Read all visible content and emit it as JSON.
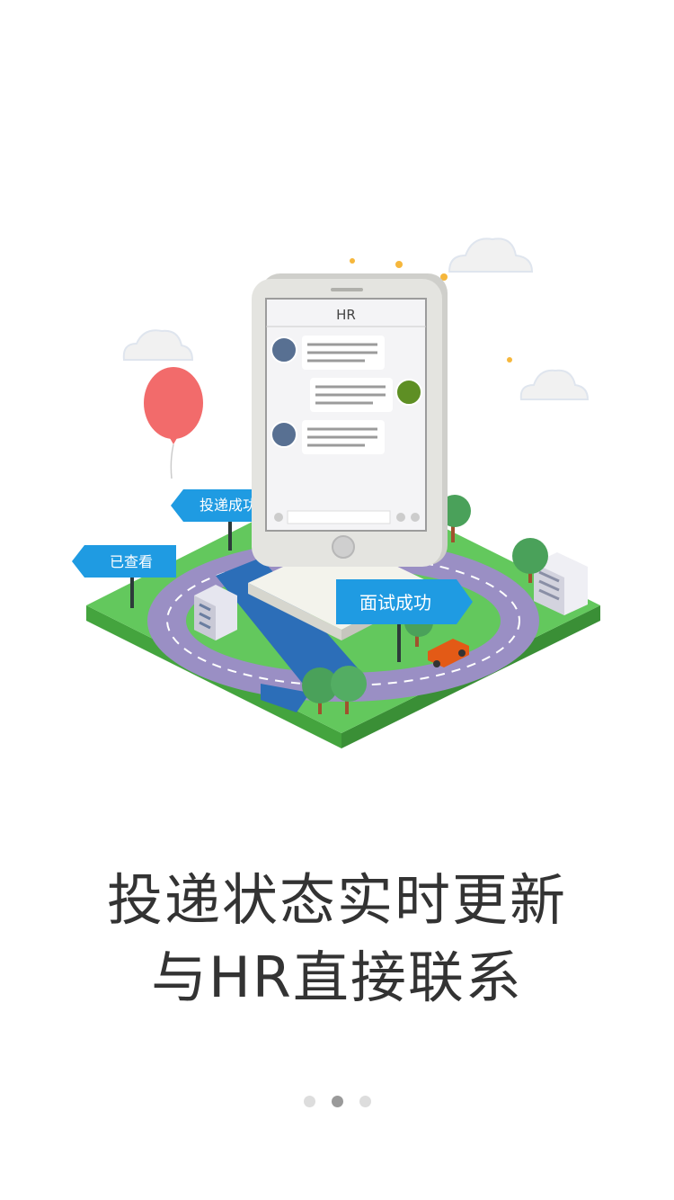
{
  "illustration": {
    "phone_header": "HR",
    "signs": {
      "viewed": "已查看",
      "delivered": "投递成功",
      "interview": "面试成功"
    }
  },
  "caption": {
    "line1": "投递状态实时更新",
    "line2": "与HR直接联系"
  },
  "pager": {
    "current_page": 2,
    "total_pages": 3
  },
  "colors": {
    "accent": "#1f9be2",
    "grass": "#5fc55a",
    "road": "#9a8fc4",
    "balloon": "#f26b6b",
    "avatar_blue": "#587092",
    "avatar_green": "#5e8f24"
  }
}
